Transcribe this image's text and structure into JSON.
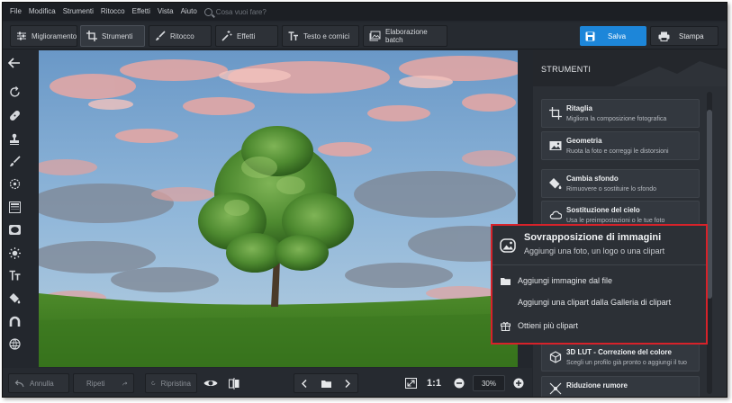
{
  "menu": {
    "items": [
      "File",
      "Modifica",
      "Strumenti",
      "Ritocco",
      "Effetti",
      "Vista",
      "Aiuto"
    ],
    "search_placeholder": "Cosa vuoi fare?"
  },
  "toolbar": {
    "tabs": [
      {
        "label": "Miglioramento",
        "icon": "sliders-icon"
      },
      {
        "label": "Strumenti",
        "icon": "crop-icon"
      },
      {
        "label": "Ritocco",
        "icon": "brush-icon"
      },
      {
        "label": "Effetti",
        "icon": "magic-wand-icon"
      },
      {
        "label": "Testo e cornici",
        "icon": "text-icon"
      },
      {
        "label": "Elaborazione batch",
        "icon": "image-stack-icon"
      }
    ],
    "active_tab": "Strumenti",
    "save_label": "Salva",
    "print_label": "Stampa"
  },
  "left_tools": [
    "back-arrow-icon",
    "rotate-icon",
    "bandage-icon",
    "stamp-icon",
    "brush-icon",
    "radial-icon",
    "gradient-icon",
    "vignette-icon",
    "sun-icon",
    "text-icon",
    "paint-bucket-icon",
    "magnet-icon",
    "globe-icon"
  ],
  "panel": {
    "title": "STRUMENTI",
    "cards": [
      {
        "title": "Ritaglia",
        "subtitle": "Migliora la composizione fotografica",
        "icon": "crop-icon"
      },
      {
        "title": "Geometria",
        "subtitle": "Ruota la foto e correggi le distorsioni",
        "icon": "image-icon"
      },
      {
        "title": "Cambia sfondo",
        "subtitle": "Rimuovere o sostituire lo sfondo",
        "icon": "paint-bucket-icon"
      },
      {
        "title": "Sostituzione del cielo",
        "subtitle": "Usa le preimpostazioni o le tue foto",
        "icon": "cloud-icon"
      },
      {
        "title": "3D LUT - Correzione del colore",
        "subtitle": "Scegli un profilo già pronto o aggiungi il tuo",
        "icon": "cube-icon"
      },
      {
        "title": "Riduzione rumore",
        "subtitle": "",
        "icon": "noise-icon"
      }
    ]
  },
  "popup": {
    "title": "Sovrapposizione di immagini",
    "subtitle": "Aggiungi una foto, un logo o una clipart",
    "items": [
      {
        "label": "Aggiungi immagine dal file",
        "icon": "folder-icon"
      },
      {
        "label": "Aggiungi una clipart dalla Galleria di clipart",
        "icon": ""
      },
      {
        "label": "Ottieni più clipart",
        "icon": "gift-icon"
      }
    ]
  },
  "bottom": {
    "undo_label": "Annulla",
    "redo_label": "Ripeti",
    "reset_label": "Ripristina",
    "ratio_label": "1:1",
    "zoom_value": "30%"
  },
  "colors": {
    "accent": "#1d86d9",
    "highlight_border": "#d7222a",
    "background": "#23272d"
  }
}
